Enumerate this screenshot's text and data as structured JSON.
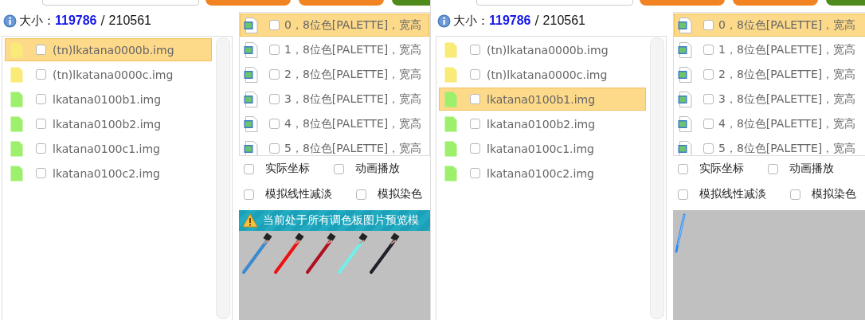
{
  "panels": [
    {
      "toolbar": {
        "buttons": [
          {
            "color": "#f28322"
          },
          {
            "color": "#f28322"
          },
          {
            "color": "#4f8a1c"
          }
        ]
      },
      "size": {
        "label": "大小：",
        "current": "119786",
        "separator": "/",
        "total": "210561"
      },
      "files": [
        {
          "name": "(tn)lkatana0000b.img",
          "color": "#faea78",
          "checked": false,
          "selected": true
        },
        {
          "name": "(tn)lkatana0000c.img",
          "color": "#faea78",
          "checked": false,
          "selected": false
        },
        {
          "name": "lkatana0100b1.img",
          "color": "#9df06c",
          "checked": false,
          "selected": false
        },
        {
          "name": "lkatana0100b2.img",
          "color": "#9df06c",
          "checked": false,
          "selected": false
        },
        {
          "name": "lkatana0100c1.img",
          "color": "#9df06c",
          "checked": false,
          "selected": false
        },
        {
          "name": "lkatana0100c2.img",
          "color": "#9df06c",
          "checked": false,
          "selected": false
        }
      ],
      "frames": [
        {
          "label": "0，8位色[PALETTE]，宽高",
          "checked": false,
          "selected": true
        },
        {
          "label": "1，8位色[PALETTE]，宽高",
          "checked": false,
          "selected": false
        },
        {
          "label": "2，8位色[PALETTE]，宽高",
          "checked": false,
          "selected": false
        },
        {
          "label": "3，8位色[PALETTE]，宽高",
          "checked": false,
          "selected": false
        },
        {
          "label": "4，8位色[PALETTE]，宽高",
          "checked": false,
          "selected": false
        },
        {
          "label": "5，8位色[PALETTE]，宽高",
          "checked": false,
          "selected": false
        }
      ],
      "options": [
        [
          {
            "label": "实际坐标",
            "checked": false
          },
          {
            "label": "动画播放",
            "checked": false
          }
        ],
        [
          {
            "label": "模拟线性减淡",
            "checked": false
          },
          {
            "label": "模拟染色",
            "checked": false
          }
        ]
      ],
      "notice": "当前处于所有调色板图片预览模",
      "swords": [
        {
          "color": "#3a8ad0"
        },
        {
          "color": "#ee1010"
        },
        {
          "color": "#b01020"
        },
        {
          "color": "#70f0e8"
        },
        {
          "color": "#222028"
        }
      ]
    },
    {
      "toolbar": {
        "buttons": [
          {
            "color": "#f28322"
          },
          {
            "color": "#f28322"
          },
          {
            "color": "#4f8a1c"
          }
        ]
      },
      "size": {
        "label": "大小：",
        "current": "119786",
        "separator": "/",
        "total": "210561"
      },
      "files": [
        {
          "name": "(tn)lkatana0000b.img",
          "color": "#faea78",
          "checked": false,
          "selected": false
        },
        {
          "name": "(tn)lkatana0000c.img",
          "color": "#faea78",
          "checked": false,
          "selected": false
        },
        {
          "name": "lkatana0100b1.img",
          "color": "#9df06c",
          "checked": false,
          "selected": true
        },
        {
          "name": "lkatana0100b2.img",
          "color": "#9df06c",
          "checked": false,
          "selected": false
        },
        {
          "name": "lkatana0100c1.img",
          "color": "#9df06c",
          "checked": false,
          "selected": false
        },
        {
          "name": "lkatana0100c2.img",
          "color": "#9df06c",
          "checked": false,
          "selected": false
        }
      ],
      "frames": [
        {
          "label": "0，8位色[PALETTE]，宽高",
          "checked": false,
          "selected": true
        },
        {
          "label": "1，8位色[PALETTE]，宽高",
          "checked": false,
          "selected": false
        },
        {
          "label": "2，8位色[PALETTE]，宽高",
          "checked": false,
          "selected": false
        },
        {
          "label": "3，8位色[PALETTE]，宽高",
          "checked": false,
          "selected": false
        },
        {
          "label": "4，8位色[PALETTE]，宽高",
          "checked": false,
          "selected": false
        },
        {
          "label": "5，8位色[PALETTE]，宽高",
          "checked": false,
          "selected": false
        }
      ],
      "options": [
        [
          {
            "label": "实际坐标",
            "checked": false
          },
          {
            "label": "动画播放",
            "checked": false
          }
        ],
        [
          {
            "label": "模拟线性减淡",
            "checked": false
          },
          {
            "label": "模拟染色",
            "checked": false
          }
        ]
      ],
      "swords": [
        {
          "color": "#2f8cf0"
        }
      ]
    }
  ]
}
